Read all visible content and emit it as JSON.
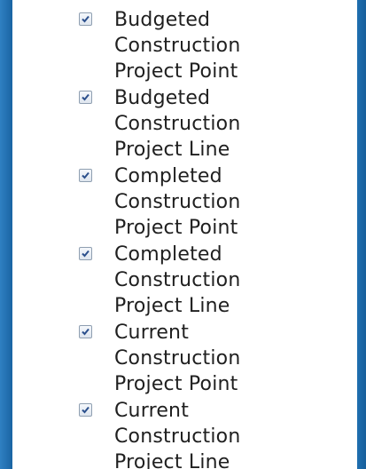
{
  "layers": {
    "items": [
      {
        "label": "Budgeted\nConstruction\nProject Point",
        "checked": true
      },
      {
        "label": "Budgeted\nConstruction\nProject Line",
        "checked": true
      },
      {
        "label": "Completed\nConstruction\nProject Point",
        "checked": true
      },
      {
        "label": "Completed\nConstruction\nProject Line",
        "checked": true
      },
      {
        "label": "Current\nConstruction\nProject Point",
        "checked": true
      },
      {
        "label": "Current\nConstruction\nProject Line",
        "checked": true
      }
    ]
  },
  "colors": {
    "frame": "#1f6fb0",
    "panel": "#ffffff",
    "text": "#1f1f1f",
    "check": "#2b4f8c"
  },
  "icons": {
    "checkbox": "checkmark-icon"
  }
}
